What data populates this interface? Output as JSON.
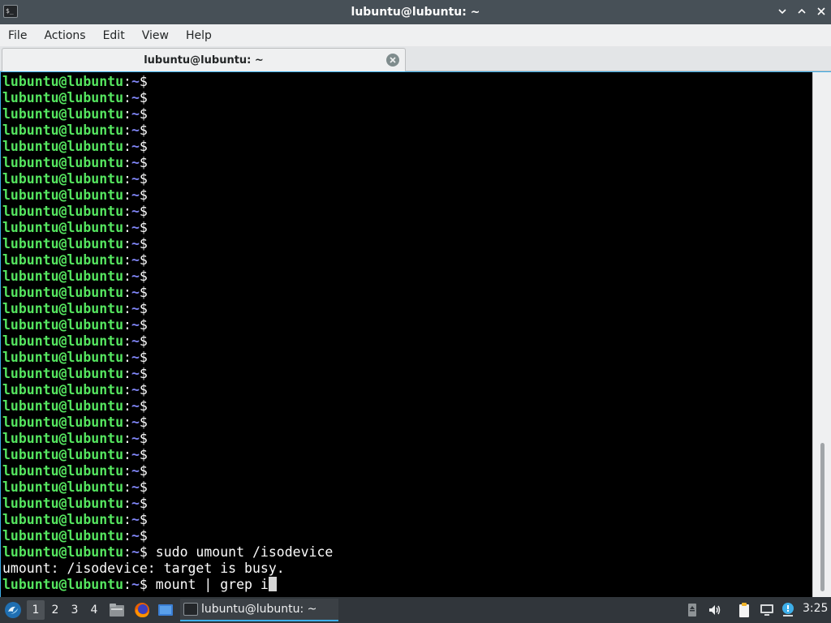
{
  "window": {
    "title": "lubuntu@lubuntu: ~",
    "icon_text": "$_",
    "buttons": [
      "minimize-icon",
      "maximize-icon",
      "close-icon"
    ]
  },
  "menubar": [
    "File",
    "Actions",
    "Edit",
    "View",
    "Help"
  ],
  "tab": {
    "label": "lubuntu@lubuntu: ~"
  },
  "terminal": {
    "prompt": {
      "user": "lubuntu@lubuntu",
      "colon": ":",
      "path": "~",
      "dollar": "$"
    },
    "lines": [
      {
        "type": "prompt",
        "cmd": ""
      },
      {
        "type": "prompt",
        "cmd": ""
      },
      {
        "type": "prompt",
        "cmd": ""
      },
      {
        "type": "prompt",
        "cmd": ""
      },
      {
        "type": "prompt",
        "cmd": ""
      },
      {
        "type": "prompt",
        "cmd": ""
      },
      {
        "type": "prompt",
        "cmd": ""
      },
      {
        "type": "prompt",
        "cmd": ""
      },
      {
        "type": "prompt",
        "cmd": ""
      },
      {
        "type": "prompt",
        "cmd": ""
      },
      {
        "type": "prompt",
        "cmd": ""
      },
      {
        "type": "prompt",
        "cmd": ""
      },
      {
        "type": "prompt",
        "cmd": ""
      },
      {
        "type": "prompt",
        "cmd": ""
      },
      {
        "type": "prompt",
        "cmd": ""
      },
      {
        "type": "prompt",
        "cmd": ""
      },
      {
        "type": "prompt",
        "cmd": ""
      },
      {
        "type": "prompt",
        "cmd": ""
      },
      {
        "type": "prompt",
        "cmd": ""
      },
      {
        "type": "prompt",
        "cmd": ""
      },
      {
        "type": "prompt",
        "cmd": ""
      },
      {
        "type": "prompt",
        "cmd": ""
      },
      {
        "type": "prompt",
        "cmd": ""
      },
      {
        "type": "prompt",
        "cmd": ""
      },
      {
        "type": "prompt",
        "cmd": ""
      },
      {
        "type": "prompt",
        "cmd": ""
      },
      {
        "type": "prompt",
        "cmd": ""
      },
      {
        "type": "prompt",
        "cmd": ""
      },
      {
        "type": "prompt",
        "cmd": ""
      },
      {
        "type": "prompt",
        "cmd": "sudo umount /isodevice"
      },
      {
        "type": "output",
        "text": "umount: /isodevice: target is busy."
      },
      {
        "type": "prompt",
        "cmd": "mount | grep i",
        "cursor": true
      }
    ]
  },
  "taskbar": {
    "desktops": [
      "1",
      "2",
      "3",
      "4"
    ],
    "active_desktop": "1",
    "quicklaunch": [
      "file-manager-icon",
      "firefox-icon",
      "show-desktop-icon"
    ],
    "task": {
      "label": "lubuntu@lubuntu: ~",
      "icon": "terminal-icon"
    },
    "tray": [
      "removable-media-icon",
      "volume-icon",
      "clipboard-icon",
      "network-icon",
      "update-notifier-icon"
    ],
    "clock": "3:25"
  },
  "colors": {
    "prompt_user": "#55e55f",
    "prompt_path": "#7f85f5",
    "accent": "#3daee9"
  }
}
